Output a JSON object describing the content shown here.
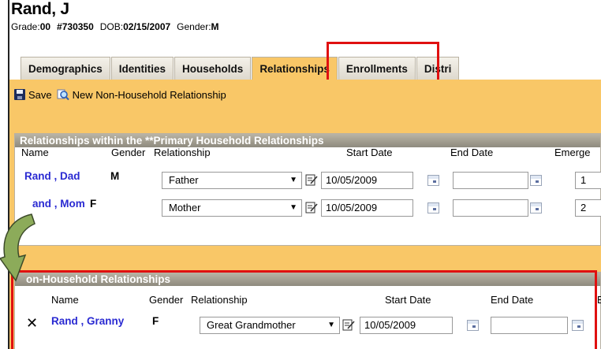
{
  "student": {
    "name": "Rand, J",
    "grade_label": "Grade:",
    "grade_value": "00",
    "id": "#730350",
    "dob_label": "DOB:",
    "dob_value": "02/15/2007",
    "gender_label": "Gender:",
    "gender_value": "M"
  },
  "tabs": [
    {
      "label": "Demographics",
      "active": false
    },
    {
      "label": "Identities",
      "active": false
    },
    {
      "label": "Households",
      "active": false
    },
    {
      "label": "Relationships",
      "active": true
    },
    {
      "label": "Enrollments",
      "active": false
    },
    {
      "label": "Distri",
      "active": false
    }
  ],
  "toolbar": {
    "save_label": "Save",
    "new_label": "New Non-Household Relationship"
  },
  "household_panel": {
    "title": "Relationships within the **Primary Household Relationships",
    "columns": {
      "name": "Name",
      "gender": "Gender",
      "relationship": "Relationship",
      "start_date": "Start Date",
      "end_date": "End Date",
      "emergency": "Emerge"
    },
    "rows": [
      {
        "name": "Rand , Dad",
        "gender": "M",
        "relationship": "Father",
        "start_date": "10/05/2009",
        "end_date": "",
        "emergency": "1"
      },
      {
        "name": "and , Mom",
        "gender": "F",
        "relationship": "Mother",
        "start_date": "10/05/2009",
        "end_date": "",
        "emergency": "2"
      }
    ]
  },
  "non_household_panel": {
    "title": "on-Household Relationships",
    "columns": {
      "name": "Name",
      "gender": "Gender",
      "relationship": "Relationship",
      "start_date": "Start Date",
      "end_date": "End Date",
      "extra": "E"
    },
    "rows": [
      {
        "name": "Rand , Granny",
        "gender": "F",
        "relationship": "Great Grandmother",
        "start_date": "10/05/2009",
        "end_date": ""
      }
    ]
  },
  "colors": {
    "content_bg": "#f9c767",
    "highlight_red": "#e01010",
    "link_blue": "#2a2ad2",
    "header_gray": "#8e8a7e",
    "arrow_green": "#8cab5a"
  },
  "icons": {
    "save": "floppy-disk-icon",
    "new": "magnifier-new-icon",
    "edit": "edit-note-icon",
    "calendar": "calendar-icon",
    "delete": "delete-x-icon",
    "arrow": "curved-arrow-icon"
  }
}
